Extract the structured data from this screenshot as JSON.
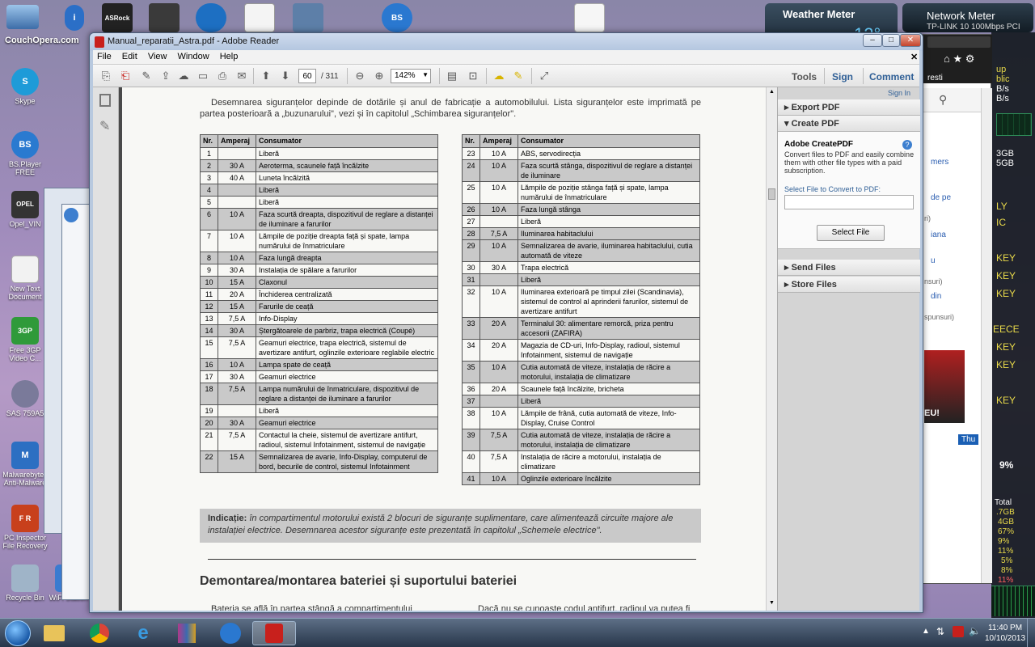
{
  "desktop": {
    "top_icons": [
      {
        "label": "ASRock"
      },
      {
        "label": ""
      },
      {
        "label": ""
      },
      {
        "label": ""
      },
      {
        "label": ""
      },
      {
        "label": "BS"
      },
      {
        "label": ""
      }
    ],
    "left_icons": [
      {
        "label": "Skype",
        "glyph": "S",
        "color": "#1e9bd8"
      },
      {
        "label": "BS.Player FREE",
        "glyph": "BS",
        "color": "#2a7ad0"
      },
      {
        "label": "Opel_VIN",
        "glyph": "OPEL",
        "color": "#333"
      },
      {
        "label": "New Text Document",
        "glyph": "",
        "color": "#f2f2f2"
      },
      {
        "label": "Free 3GP Video C...",
        "glyph": "3GP",
        "color": "#2f9a3a"
      },
      {
        "label": "SAS 759A5",
        "glyph": "",
        "color": "#7a7a9a"
      },
      {
        "label": "Malwarebytes Anti-Malware",
        "glyph": "M",
        "color": "#2c6fc2"
      },
      {
        "label": "PC Inspector File Recovery",
        "glyph": "F R",
        "color": "#c8401c"
      },
      {
        "label": "Recycle Bin",
        "glyph": "",
        "color": "#9fb4c8"
      },
      {
        "label": "WiFi Station",
        "glyph": "",
        "color": "#3a7bd0"
      }
    ],
    "top_left_text": "CouchOpera.com"
  },
  "gadgets": {
    "weather_title": "Weather Meter",
    "weather_temp": "12°",
    "network_title": "Network Meter",
    "network_sub": "TP-LINK 10 100Mbps PCI",
    "side_lines": [
      "up",
      "blic",
      "B/s",
      "B/s",
      "3GB",
      "5GB",
      "LY",
      "IC",
      "KEY",
      "KEY",
      "KEY",
      "EECE",
      "KEY",
      "KEY",
      "KEY"
    ],
    "cpu": "9%",
    "mem_lines": [
      "Total",
      ".7GB",
      "4GB",
      "67%",
      "9%",
      "11%",
      "5%",
      "8%",
      "11%"
    ]
  },
  "browser": {
    "fragments": [
      "resti",
      "mers",
      "de pe",
      "ri)",
      "iana",
      "u",
      "nsuri)",
      "din",
      "spunsuri)",
      "Thu",
      "EU!"
    ]
  },
  "reader": {
    "title": "Manual_reparatii_Astra.pdf - Adobe Reader",
    "menu": [
      "File",
      "Edit",
      "View",
      "Window",
      "Help"
    ],
    "page_current": "60",
    "page_total": "/ 311",
    "zoom": "142%",
    "tools": "Tools",
    "sign": "Sign",
    "comment": "Comment",
    "sign_in": "Sign In",
    "export_pdf": "Export PDF",
    "create_pdf": "Create PDF",
    "createpdf_title": "Adobe CreatePDF",
    "createpdf_desc": "Convert files to PDF and easily combine them with other file types with a paid subscription.",
    "select_file_link": "Select File to Convert to PDF:",
    "select_file_btn": "Select File",
    "send_files": "Send Files",
    "store_files": "Store Files"
  },
  "document": {
    "intro": "Desemnarea siguranțelor depinde de dotările și anul de fabricație a automobilului. Lista siguranțelor este imprimată pe partea posterioară a „buzunarului\", vezi și în capitolul „Schimbarea siguranțelor\".",
    "headers": [
      "Nr.",
      "Amperaj",
      "Consumator"
    ],
    "table_left": [
      [
        "1",
        "",
        "Liberă"
      ],
      [
        "2",
        "30 A",
        "Aeroterma, scaunele față încălzite"
      ],
      [
        "3",
        "40 A",
        "Luneta încălzită"
      ],
      [
        "4",
        "",
        "Liberă"
      ],
      [
        "5",
        "",
        "Liberă"
      ],
      [
        "6",
        "10 A",
        "Faza scurtă dreapta, dispozitivul de reglare a distanței de iluminare a farurilor"
      ],
      [
        "7",
        "10 A",
        "Lămpile de poziție dreapta față și spate, lampa numărului de înmatriculare"
      ],
      [
        "8",
        "10 A",
        "Faza lungă dreapta"
      ],
      [
        "9",
        "30 A",
        "Instalația de spălare a farurilor"
      ],
      [
        "10",
        "15 A",
        "Claxonul"
      ],
      [
        "11",
        "20 A",
        "Închiderea centralizată"
      ],
      [
        "12",
        "15 A",
        "Farurile de ceață"
      ],
      [
        "13",
        "7,5 A",
        "Info-Display"
      ],
      [
        "14",
        "30 A",
        "Ștergătoarele de parbriz, trapa electrică (Coupé)"
      ],
      [
        "15",
        "7,5 A",
        "Geamuri electrice, trapa electrică, sistemul de avertizare antifurt, oglinzile exterioare reglabile electric"
      ],
      [
        "16",
        "10 A",
        "Lampa spate de ceață"
      ],
      [
        "17",
        "30 A",
        "Geamuri electrice"
      ],
      [
        "18",
        "7,5 A",
        "Lampa numărului de înmatriculare, dispozitivul de reglare a distanței de iluminare a farurilor"
      ],
      [
        "19",
        "",
        "Liberă"
      ],
      [
        "20",
        "30 A",
        "Geamuri electrice"
      ],
      [
        "21",
        "7,5 A",
        "Contactul la cheie, sistemul de avertizare antifurt, radioul, sistemul Infotainment, sistemul de navigație"
      ],
      [
        "22",
        "15 A",
        "Semnalizarea de avarie, Info-Display, computerul de bord, becurile de control, sistemul Infotainment"
      ]
    ],
    "table_right": [
      [
        "23",
        "10 A",
        "ABS, servodirecția"
      ],
      [
        "24",
        "10 A",
        "Faza scurtă stânga, dispozitivul de reglare a distanței de iluminare"
      ],
      [
        "25",
        "10 A",
        "Lămpile de poziție stânga față și spate, lampa numărului de înmatriculare"
      ],
      [
        "26",
        "10 A",
        "Faza lungă stânga"
      ],
      [
        "27",
        "",
        "Liberă"
      ],
      [
        "28",
        "7,5 A",
        "Iluminarea habitaclului"
      ],
      [
        "29",
        "10 A",
        "Semnalizarea de avarie, iluminarea habitaclului, cutia automată de viteze"
      ],
      [
        "30",
        "30 A",
        "Trapa electrică"
      ],
      [
        "31",
        "",
        "Liberă"
      ],
      [
        "32",
        "10 A",
        "Iluminarea exterioară pe timpul zilei (Scandinavia), sistemul de control al aprinderii farurilor, sistemul de avertizare antifurt"
      ],
      [
        "33",
        "20 A",
        "Terminalul 30: alimentare remorcă, priza pentru accesorii (ZAFIRA)"
      ],
      [
        "34",
        "20 A",
        "Magazia de CD-uri, Info-Display, radioul, sistemul Infotainment, sistemul de navigație"
      ],
      [
        "35",
        "10 A",
        "Cutia automată de viteze, instalația de răcire a motorului, instalația de climatizare"
      ],
      [
        "36",
        "20 A",
        "Scaunele față încălzite, bricheta"
      ],
      [
        "37",
        "",
        "Liberă"
      ],
      [
        "38",
        "10 A",
        "Lămpile de frână, cutia automată de viteze, Info-Display, Cruise Control"
      ],
      [
        "39",
        "7,5 A",
        "Cutia automată de viteze, instalația de răcire a motorului, instalația de climatizare"
      ],
      [
        "40",
        "7,5 A",
        "Instalația de răcire a motorului, instalația de climatizare"
      ],
      [
        "41",
        "10 A",
        "Oglinzile exterioare încălzite"
      ]
    ],
    "shade_left": [
      2,
      4,
      6,
      8,
      10,
      12,
      14,
      16,
      18,
      20,
      22
    ],
    "shade_right": [
      24,
      26,
      28,
      29,
      31,
      33,
      35,
      37,
      39,
      41
    ],
    "note_label": "Indicație:",
    "note_text": " în compartimentul motorului există 2 blocuri de siguranțe suplimentare, care alimentează circuite majore ale instalației electrice. Desemnarea acestor siguranțe este prezentată în capitolul „Schemele electrice\".",
    "section_title": "Demontarea/montarea bateriei și suportului bateriei",
    "foot_left": "Bateria se află în partea stângă a compartimentului",
    "foot_right": "Dacă nu se cunoaște codul antifurt, radioul va putea fi"
  },
  "taskbar": {
    "time": "11:40 PM",
    "date": "10/10/2013"
  },
  "colors": {
    "pdf_red": "#c8201c",
    "accent_blue": "#2f5f96"
  }
}
